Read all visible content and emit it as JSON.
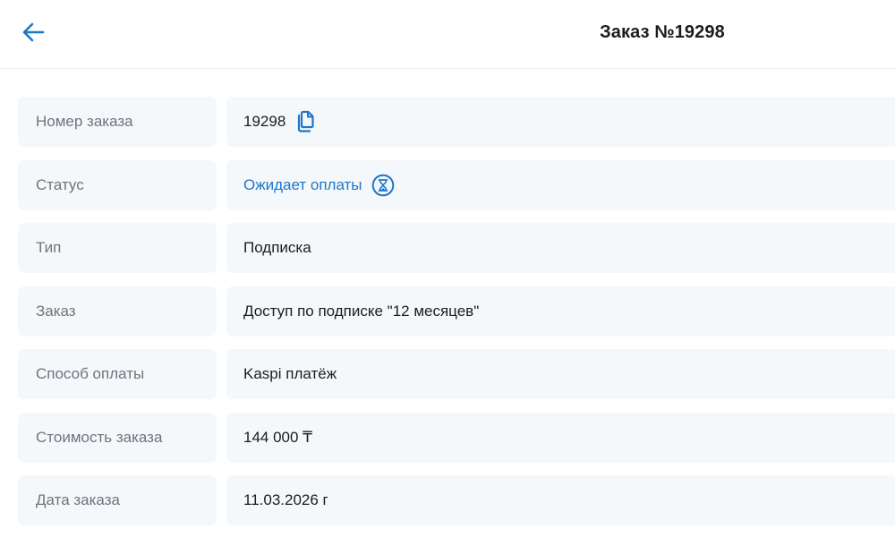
{
  "header": {
    "title": "Заказ №19298"
  },
  "order": {
    "rows": [
      {
        "label": "Номер заказа",
        "value": "19298"
      },
      {
        "label": "Статус",
        "value": "Ожидает оплаты"
      },
      {
        "label": "Тип",
        "value": "Подписка"
      },
      {
        "label": "Заказ",
        "value": "Доступ по подписке \"12 месяцев\""
      },
      {
        "label": "Способ оплаты",
        "value": "Kaspi платёж"
      },
      {
        "label": "Стоимость заказа",
        "value": "144 000 ₸"
      },
      {
        "label": "Дата заказа",
        "value": "11.03.2026 г"
      }
    ]
  },
  "icons": {
    "back": "arrow-left-icon",
    "copy": "copy-icon",
    "status": "hourglass-icon"
  },
  "colors": {
    "accent": "#1e76c8",
    "row_background": "#f5f8fb",
    "label_text": "#6f747c",
    "value_text": "#1c1c1c"
  }
}
